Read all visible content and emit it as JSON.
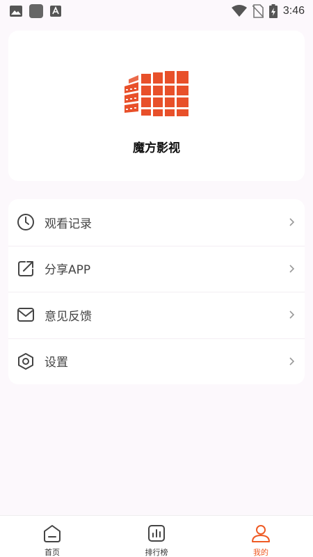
{
  "status_bar": {
    "time": "3:46",
    "icons": [
      "image-icon",
      "square-app-icon",
      "a-text-icon",
      "wifi-icon",
      "no-sim-icon",
      "battery-charging-icon"
    ]
  },
  "header": {
    "logo_icon": "building-grid-logo",
    "app_name": "魔方影视"
  },
  "menu": {
    "items": [
      {
        "label": "观看记录",
        "icon": "clock-icon"
      },
      {
        "label": "分享APP",
        "icon": "share-icon"
      },
      {
        "label": "意见反馈",
        "icon": "mail-icon"
      },
      {
        "label": "设置",
        "icon": "hexagon-settings-icon"
      }
    ]
  },
  "bottom_nav": {
    "items": [
      {
        "label": "首页",
        "icon": "home-icon",
        "active": false
      },
      {
        "label": "排行榜",
        "icon": "chart-icon",
        "active": false
      },
      {
        "label": "我的",
        "icon": "user-icon",
        "active": true
      }
    ]
  },
  "colors": {
    "accent": "#ee5a24",
    "background": "#fcf8fc",
    "card": "#ffffff",
    "text": "#444444"
  }
}
